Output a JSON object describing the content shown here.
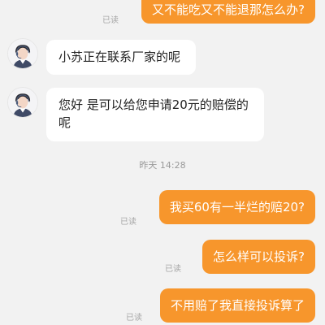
{
  "messages": [
    {
      "direction": "out",
      "text": "又不能吃又不能退那怎么办?",
      "status": "已读"
    },
    {
      "direction": "in",
      "text": "小苏正在联系厂家的呢",
      "avatar": "customer-service-agent-avatar"
    },
    {
      "direction": "in",
      "text": "您好 是可以给您申请20元的赔偿的呢",
      "avatar": "customer-service-agent-avatar"
    },
    {
      "direction": "out",
      "text": "我买60有一半烂的赔20?",
      "status": "已读"
    },
    {
      "direction": "out",
      "text": "怎么样可以投诉?",
      "status": "已读"
    },
    {
      "direction": "out",
      "text": "不用赔了我直接投诉算了",
      "status": "已读"
    }
  ],
  "timestamp": "昨天 14:28",
  "colors": {
    "outgoing_bubble": "#f7962c",
    "incoming_bubble": "#ffffff",
    "background": "#f2f2f2",
    "read_status": "#a6a6a6"
  }
}
